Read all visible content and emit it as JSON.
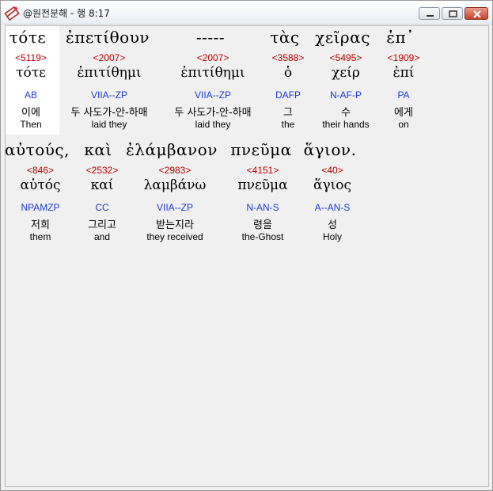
{
  "window": {
    "title": "@원전분해 - 행 8:17",
    "icon": "book-icon",
    "controls": [
      "minimize-icon",
      "maximize-icon",
      "close-icon"
    ]
  },
  "text_line1": [
    "τότε",
    "ἐπετίθουν",
    "-----",
    "τὰς",
    "χεῖρας",
    "ἐπ᾽"
  ],
  "text_line2": [
    "αὐτούς,",
    "καὶ",
    "ἐλάμβανον",
    "πνεῦμα",
    "ἅγιον."
  ],
  "words": [
    {
      "strong": "<5119>",
      "lemma": "τότε",
      "morph": "AB",
      "korean": "이에",
      "english": "Then"
    },
    {
      "strong": "<2007>",
      "lemma": "ἐπιτίθημι",
      "morph": "VIIA--ZP",
      "korean": "두 사도가-안-하매",
      "english": "laid they"
    },
    {
      "strong": "<2007>",
      "lemma": "ἐπιτίθημι",
      "morph": "VIIA--ZP",
      "korean": "두 사도가-안-하매",
      "english": "laid they"
    },
    {
      "strong": "<3588>",
      "lemma": "ὁ",
      "morph": "DAFP",
      "korean": "그",
      "english": "the"
    },
    {
      "strong": "<5495>",
      "lemma": "χείρ",
      "morph": "N-AF-P",
      "korean": "수",
      "english": "their hands"
    },
    {
      "strong": "<1909>",
      "lemma": "ἐπί",
      "morph": "PA",
      "korean": "에게",
      "english": "on"
    },
    {
      "strong": "<846>",
      "lemma": "αὐτός",
      "morph": "NPAMZP",
      "korean": "저희",
      "english": "them"
    },
    {
      "strong": "<2532>",
      "lemma": "καί",
      "morph": "CC",
      "korean": "그리고",
      "english": "and"
    },
    {
      "strong": "<2983>",
      "lemma": "λαμβάνω",
      "morph": "VIIA--ZP",
      "korean": "받는지라",
      "english": "they received"
    },
    {
      "strong": "<4151>",
      "lemma": "πνεῦμα",
      "morph": "N-AN-S",
      "korean": "령을",
      "english": "the-Ghost"
    },
    {
      "strong": "<40>",
      "lemma": "ἅγιος",
      "morph": "A--AN-S",
      "korean": "성",
      "english": "Holy"
    }
  ],
  "colors": {
    "strong": "#b80000",
    "morph": "#1f3bd6",
    "highlight": "#ffffff"
  }
}
